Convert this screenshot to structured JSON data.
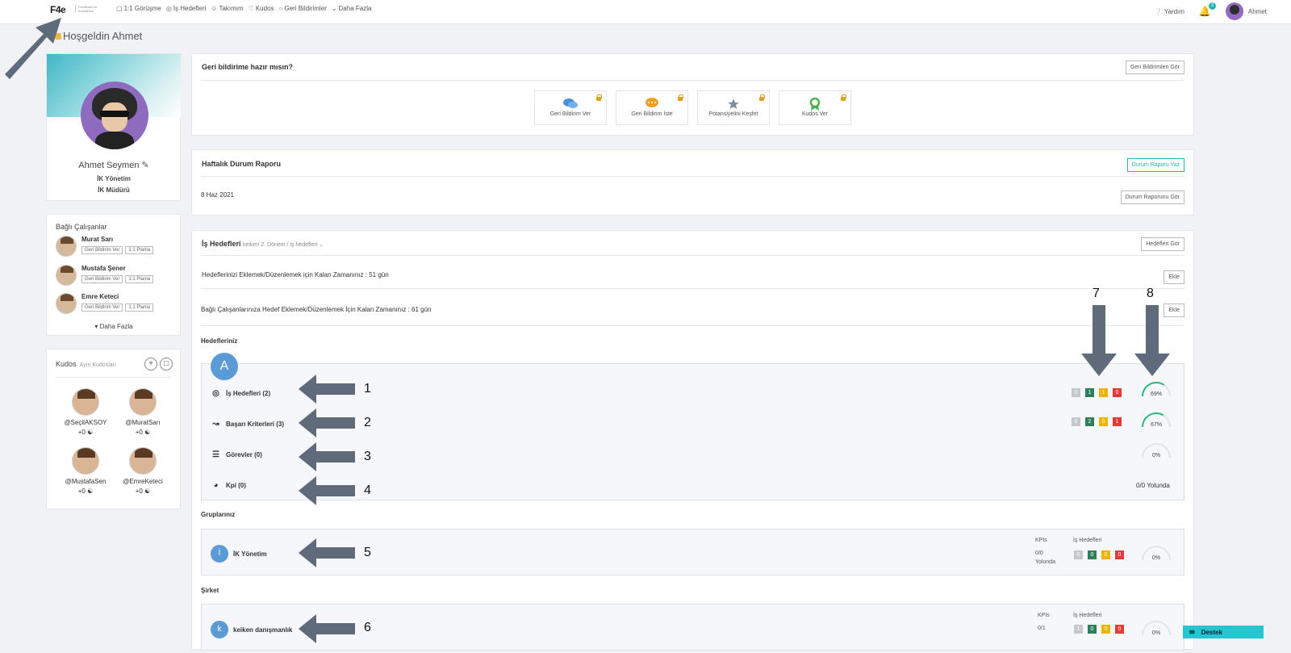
{
  "nav": {
    "logo": "F4e",
    "logo_tagline": "Feedback for Excellence",
    "items": [
      {
        "icon": "chat-icon",
        "label": "1:1 Görüşme"
      },
      {
        "icon": "target-icon",
        "label": "İş Hedefleri"
      },
      {
        "icon": "team-icon",
        "label": "Takımım"
      },
      {
        "icon": "kudos-icon",
        "label": "Kudos"
      },
      {
        "icon": "comment-icon",
        "label": "Geri Bildirimler"
      },
      {
        "icon": "chevron-down-icon",
        "label": "Daha Fazla"
      }
    ],
    "help": "Yardım",
    "notifications": "3",
    "user": "Ahmet"
  },
  "welcome": "Hoşgeldin Ahmet",
  "profile": {
    "name": "Ahmet Seymen",
    "dept": "İK Yönetim",
    "title": "İK Müdürü"
  },
  "employees": {
    "title": "Bağlı Çalışanlar",
    "list": [
      {
        "name": "Murat Sarı",
        "btn1": "Geri Bildirim Ver",
        "btn2": "1:1 Planla"
      },
      {
        "name": "Mustafa Şener",
        "btn1": "Geri Bildirim Ver",
        "btn2": "1:1 Planla"
      },
      {
        "name": "Emre Keteci",
        "btn1": "Geri Bildirim Ver",
        "btn2": "1:1 Planla"
      }
    ],
    "more": "Daha Fazla"
  },
  "kudos": {
    "title": "Kudos",
    "subtitle": "Ayın Kudosları",
    "people": [
      {
        "handle": "@SeçilAKSOY",
        "count": "+0"
      },
      {
        "handle": "@MuratSarı",
        "count": "+0"
      },
      {
        "handle": "@MustafaSen",
        "count": "+0"
      },
      {
        "handle": "@EmreKeteci",
        "count": "+0"
      }
    ]
  },
  "feedback": {
    "title": "Geri bildirime hazır mısın?",
    "view_btn": "Geri Bildirimleri Gör",
    "tiles": [
      {
        "label": "Geri Bildirim Ver",
        "icon": "chat-bubbles-icon",
        "color": "#4a90d9"
      },
      {
        "label": "Geri Bildirim İste",
        "icon": "speech-bubble-icon",
        "color": "#f0a020"
      },
      {
        "label": "Potansiyelini Keşfet",
        "icon": "star-icon",
        "color": "#7f8c9a"
      },
      {
        "label": "Kudos Ver",
        "icon": "award-icon",
        "color": "#4caf50"
      }
    ]
  },
  "weekly": {
    "title": "Haftalık Durum Raporu",
    "write_btn": "Durum Raporu Yaz",
    "date": "8 Haz 2021",
    "view_btn": "Durum Raporunu Gör"
  },
  "goals": {
    "title": "İş Hedefleri",
    "breadcrumb": "keiken 2. Dönem / iş hedefleri",
    "view_btn": "Hedefleri Gör",
    "remaining1": "Hedeflerinizi Eklemek/Düzenlemek için Kalan Zamanınız : 51 gün",
    "remaining2": "Bağlı Çalışanlarınıza Hedef Eklemek/Düzenlemek İçin Kalan Zamanınız : 61 gün",
    "add_btn": "Ekle",
    "your_goals": "Hedefleriniz",
    "avatar_letter": "A",
    "rows": [
      {
        "label": "İş Hedefleri (2)",
        "icon": "target-icon",
        "counts": [
          "0",
          "1",
          "1",
          "0"
        ],
        "gauge": 69
      },
      {
        "label": "Başarı Kriterleri (3)",
        "icon": "chart-line-icon",
        "counts": [
          "0",
          "2",
          "0",
          "1"
        ],
        "gauge": 67
      },
      {
        "label": "Görevler (0)",
        "icon": "task-list-icon",
        "gauge": 0
      },
      {
        "label": "Kpi (0)",
        "icon": "speedometer-icon",
        "status": "0/0 Yolunda"
      }
    ],
    "groups_label": "Gruplarınız",
    "group": {
      "letter": "İ",
      "name": "İK Yönetim",
      "kpi_label": "KPIs",
      "kpi_value": "0/0",
      "kpi_status": "Yolunda",
      "goals_label": "İş Hedefleri",
      "counts": [
        "0",
        "0",
        "0",
        "0"
      ],
      "gauge": 0
    },
    "company_label": "Şirket",
    "company": {
      "letter": "k",
      "name": "keiken danışmanlık",
      "kpi_label": "KPIs",
      "kpi_value": "0/1",
      "goals_label": "İş Hedefleri",
      "counts": [
        "1",
        "0",
        "0",
        "0"
      ],
      "gauge": 0
    }
  },
  "annotations": [
    "1",
    "2",
    "3",
    "4",
    "5",
    "6",
    "7",
    "8"
  ],
  "support": "Destek"
}
